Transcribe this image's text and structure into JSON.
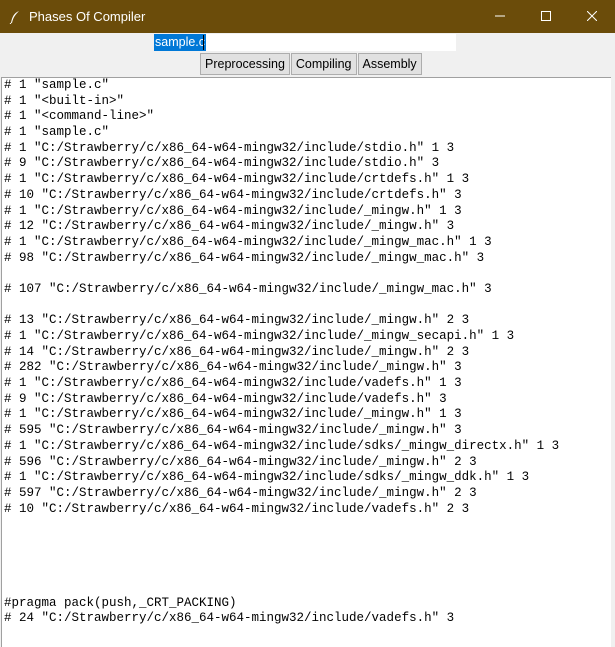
{
  "window": {
    "title": "Phases Of Compiler",
    "icon": "feather-icon",
    "titlebar_color": "#6b4c0a"
  },
  "file_input": {
    "value": "sample.c"
  },
  "buttons": {
    "preprocessing": "Preprocessing",
    "compiling": "Compiling",
    "assembly": "Assembly"
  },
  "output": {
    "lines": [
      "# 1 \"sample.c\"",
      "# 1 \"<built-in>\"",
      "# 1 \"<command-line>\"",
      "# 1 \"sample.c\"",
      "# 1 \"C:/Strawberry/c/x86_64-w64-mingw32/include/stdio.h\" 1 3",
      "# 9 \"C:/Strawberry/c/x86_64-w64-mingw32/include/stdio.h\" 3",
      "# 1 \"C:/Strawberry/c/x86_64-w64-mingw32/include/crtdefs.h\" 1 3",
      "# 10 \"C:/Strawberry/c/x86_64-w64-mingw32/include/crtdefs.h\" 3",
      "# 1 \"C:/Strawberry/c/x86_64-w64-mingw32/include/_mingw.h\" 1 3",
      "# 12 \"C:/Strawberry/c/x86_64-w64-mingw32/include/_mingw.h\" 3",
      "# 1 \"C:/Strawberry/c/x86_64-w64-mingw32/include/_mingw_mac.h\" 1 3",
      "# 98 \"C:/Strawberry/c/x86_64-w64-mingw32/include/_mingw_mac.h\" 3",
      "",
      "# 107 \"C:/Strawberry/c/x86_64-w64-mingw32/include/_mingw_mac.h\" 3",
      "",
      "# 13 \"C:/Strawberry/c/x86_64-w64-mingw32/include/_mingw.h\" 2 3",
      "# 1 \"C:/Strawberry/c/x86_64-w64-mingw32/include/_mingw_secapi.h\" 1 3",
      "# 14 \"C:/Strawberry/c/x86_64-w64-mingw32/include/_mingw.h\" 2 3",
      "# 282 \"C:/Strawberry/c/x86_64-w64-mingw32/include/_mingw.h\" 3",
      "# 1 \"C:/Strawberry/c/x86_64-w64-mingw32/include/vadefs.h\" 1 3",
      "# 9 \"C:/Strawberry/c/x86_64-w64-mingw32/include/vadefs.h\" 3",
      "# 1 \"C:/Strawberry/c/x86_64-w64-mingw32/include/_mingw.h\" 1 3",
      "# 595 \"C:/Strawberry/c/x86_64-w64-mingw32/include/_mingw.h\" 3",
      "# 1 \"C:/Strawberry/c/x86_64-w64-mingw32/include/sdks/_mingw_directx.h\" 1 3",
      "# 596 \"C:/Strawberry/c/x86_64-w64-mingw32/include/_mingw.h\" 2 3",
      "# 1 \"C:/Strawberry/c/x86_64-w64-mingw32/include/sdks/_mingw_ddk.h\" 1 3",
      "# 597 \"C:/Strawberry/c/x86_64-w64-mingw32/include/_mingw.h\" 2 3",
      "# 10 \"C:/Strawberry/c/x86_64-w64-mingw32/include/vadefs.h\" 2 3",
      "",
      "",
      "",
      "",
      "",
      "#pragma pack(push,_CRT_PACKING)",
      "# 24 \"C:/Strawberry/c/x86_64-w64-mingw32/include/vadefs.h\" 3",
      ""
    ]
  }
}
